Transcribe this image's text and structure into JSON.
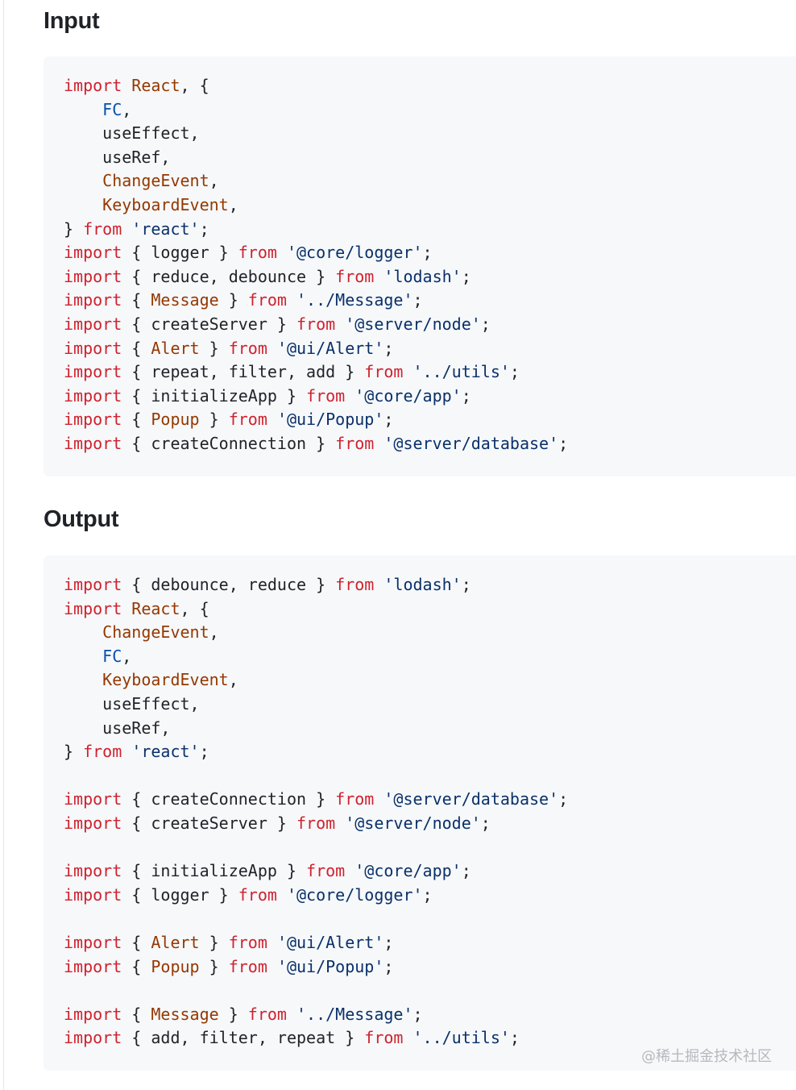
{
  "sections": [
    {
      "heading": "Input",
      "lines": [
        [
          {
            "t": "import",
            "c": "keyword"
          },
          {
            "t": " ",
            "c": "plain"
          },
          {
            "t": "React",
            "c": "ident"
          },
          {
            "t": ", {",
            "c": "plain"
          }
        ],
        [
          {
            "t": "    ",
            "c": "plain"
          },
          {
            "t": "FC",
            "c": "const"
          },
          {
            "t": ",",
            "c": "plain"
          }
        ],
        [
          {
            "t": "    useEffect,",
            "c": "plain"
          }
        ],
        [
          {
            "t": "    useRef,",
            "c": "plain"
          }
        ],
        [
          {
            "t": "    ",
            "c": "plain"
          },
          {
            "t": "ChangeEvent",
            "c": "ident"
          },
          {
            "t": ",",
            "c": "plain"
          }
        ],
        [
          {
            "t": "    ",
            "c": "plain"
          },
          {
            "t": "KeyboardEvent",
            "c": "ident"
          },
          {
            "t": ",",
            "c": "plain"
          }
        ],
        [
          {
            "t": "} ",
            "c": "plain"
          },
          {
            "t": "from",
            "c": "keyword"
          },
          {
            "t": " ",
            "c": "plain"
          },
          {
            "t": "'react'",
            "c": "string"
          },
          {
            "t": ";",
            "c": "plain"
          }
        ],
        [
          {
            "t": "import",
            "c": "keyword"
          },
          {
            "t": " { logger } ",
            "c": "plain"
          },
          {
            "t": "from",
            "c": "keyword"
          },
          {
            "t": " ",
            "c": "plain"
          },
          {
            "t": "'@core/logger'",
            "c": "string"
          },
          {
            "t": ";",
            "c": "plain"
          }
        ],
        [
          {
            "t": "import",
            "c": "keyword"
          },
          {
            "t": " { reduce, debounce } ",
            "c": "plain"
          },
          {
            "t": "from",
            "c": "keyword"
          },
          {
            "t": " ",
            "c": "plain"
          },
          {
            "t": "'lodash'",
            "c": "string"
          },
          {
            "t": ";",
            "c": "plain"
          }
        ],
        [
          {
            "t": "import",
            "c": "keyword"
          },
          {
            "t": " { ",
            "c": "plain"
          },
          {
            "t": "Message",
            "c": "ident"
          },
          {
            "t": " } ",
            "c": "plain"
          },
          {
            "t": "from",
            "c": "keyword"
          },
          {
            "t": " ",
            "c": "plain"
          },
          {
            "t": "'../Message'",
            "c": "string"
          },
          {
            "t": ";",
            "c": "plain"
          }
        ],
        [
          {
            "t": "import",
            "c": "keyword"
          },
          {
            "t": " { createServer } ",
            "c": "plain"
          },
          {
            "t": "from",
            "c": "keyword"
          },
          {
            "t": " ",
            "c": "plain"
          },
          {
            "t": "'@server/node'",
            "c": "string"
          },
          {
            "t": ";",
            "c": "plain"
          }
        ],
        [
          {
            "t": "import",
            "c": "keyword"
          },
          {
            "t": " { ",
            "c": "plain"
          },
          {
            "t": "Alert",
            "c": "ident"
          },
          {
            "t": " } ",
            "c": "plain"
          },
          {
            "t": "from",
            "c": "keyword"
          },
          {
            "t": " ",
            "c": "plain"
          },
          {
            "t": "'@ui/Alert'",
            "c": "string"
          },
          {
            "t": ";",
            "c": "plain"
          }
        ],
        [
          {
            "t": "import",
            "c": "keyword"
          },
          {
            "t": " { repeat, filter, add } ",
            "c": "plain"
          },
          {
            "t": "from",
            "c": "keyword"
          },
          {
            "t": " ",
            "c": "plain"
          },
          {
            "t": "'../utils'",
            "c": "string"
          },
          {
            "t": ";",
            "c": "plain"
          }
        ],
        [
          {
            "t": "import",
            "c": "keyword"
          },
          {
            "t": " { initializeApp } ",
            "c": "plain"
          },
          {
            "t": "from",
            "c": "keyword"
          },
          {
            "t": " ",
            "c": "plain"
          },
          {
            "t": "'@core/app'",
            "c": "string"
          },
          {
            "t": ";",
            "c": "plain"
          }
        ],
        [
          {
            "t": "import",
            "c": "keyword"
          },
          {
            "t": " { ",
            "c": "plain"
          },
          {
            "t": "Popup",
            "c": "ident"
          },
          {
            "t": " } ",
            "c": "plain"
          },
          {
            "t": "from",
            "c": "keyword"
          },
          {
            "t": " ",
            "c": "plain"
          },
          {
            "t": "'@ui/Popup'",
            "c": "string"
          },
          {
            "t": ";",
            "c": "plain"
          }
        ],
        [
          {
            "t": "import",
            "c": "keyword"
          },
          {
            "t": " { createConnection } ",
            "c": "plain"
          },
          {
            "t": "from",
            "c": "keyword"
          },
          {
            "t": " ",
            "c": "plain"
          },
          {
            "t": "'@server/database'",
            "c": "string"
          },
          {
            "t": ";",
            "c": "plain"
          }
        ]
      ]
    },
    {
      "heading": "Output",
      "lines": [
        [
          {
            "t": "import",
            "c": "keyword"
          },
          {
            "t": " { debounce, reduce } ",
            "c": "plain"
          },
          {
            "t": "from",
            "c": "keyword"
          },
          {
            "t": " ",
            "c": "plain"
          },
          {
            "t": "'lodash'",
            "c": "string"
          },
          {
            "t": ";",
            "c": "plain"
          }
        ],
        [
          {
            "t": "import",
            "c": "keyword"
          },
          {
            "t": " ",
            "c": "plain"
          },
          {
            "t": "React",
            "c": "ident"
          },
          {
            "t": ", {",
            "c": "plain"
          }
        ],
        [
          {
            "t": "    ",
            "c": "plain"
          },
          {
            "t": "ChangeEvent",
            "c": "ident"
          },
          {
            "t": ",",
            "c": "plain"
          }
        ],
        [
          {
            "t": "    ",
            "c": "plain"
          },
          {
            "t": "FC",
            "c": "const"
          },
          {
            "t": ",",
            "c": "plain"
          }
        ],
        [
          {
            "t": "    ",
            "c": "plain"
          },
          {
            "t": "KeyboardEvent",
            "c": "ident"
          },
          {
            "t": ",",
            "c": "plain"
          }
        ],
        [
          {
            "t": "    useEffect,",
            "c": "plain"
          }
        ],
        [
          {
            "t": "    useRef,",
            "c": "plain"
          }
        ],
        [
          {
            "t": "} ",
            "c": "plain"
          },
          {
            "t": "from",
            "c": "keyword"
          },
          {
            "t": " ",
            "c": "plain"
          },
          {
            "t": "'react'",
            "c": "string"
          },
          {
            "t": ";",
            "c": "plain"
          }
        ],
        [],
        [
          {
            "t": "import",
            "c": "keyword"
          },
          {
            "t": " { createConnection } ",
            "c": "plain"
          },
          {
            "t": "from",
            "c": "keyword"
          },
          {
            "t": " ",
            "c": "plain"
          },
          {
            "t": "'@server/database'",
            "c": "string"
          },
          {
            "t": ";",
            "c": "plain"
          }
        ],
        [
          {
            "t": "import",
            "c": "keyword"
          },
          {
            "t": " { createServer } ",
            "c": "plain"
          },
          {
            "t": "from",
            "c": "keyword"
          },
          {
            "t": " ",
            "c": "plain"
          },
          {
            "t": "'@server/node'",
            "c": "string"
          },
          {
            "t": ";",
            "c": "plain"
          }
        ],
        [],
        [
          {
            "t": "import",
            "c": "keyword"
          },
          {
            "t": " { initializeApp } ",
            "c": "plain"
          },
          {
            "t": "from",
            "c": "keyword"
          },
          {
            "t": " ",
            "c": "plain"
          },
          {
            "t": "'@core/app'",
            "c": "string"
          },
          {
            "t": ";",
            "c": "plain"
          }
        ],
        [
          {
            "t": "import",
            "c": "keyword"
          },
          {
            "t": " { logger } ",
            "c": "plain"
          },
          {
            "t": "from",
            "c": "keyword"
          },
          {
            "t": " ",
            "c": "plain"
          },
          {
            "t": "'@core/logger'",
            "c": "string"
          },
          {
            "t": ";",
            "c": "plain"
          }
        ],
        [],
        [
          {
            "t": "import",
            "c": "keyword"
          },
          {
            "t": " { ",
            "c": "plain"
          },
          {
            "t": "Alert",
            "c": "ident"
          },
          {
            "t": " } ",
            "c": "plain"
          },
          {
            "t": "from",
            "c": "keyword"
          },
          {
            "t": " ",
            "c": "plain"
          },
          {
            "t": "'@ui/Alert'",
            "c": "string"
          },
          {
            "t": ";",
            "c": "plain"
          }
        ],
        [
          {
            "t": "import",
            "c": "keyword"
          },
          {
            "t": " { ",
            "c": "plain"
          },
          {
            "t": "Popup",
            "c": "ident"
          },
          {
            "t": " } ",
            "c": "plain"
          },
          {
            "t": "from",
            "c": "keyword"
          },
          {
            "t": " ",
            "c": "plain"
          },
          {
            "t": "'@ui/Popup'",
            "c": "string"
          },
          {
            "t": ";",
            "c": "plain"
          }
        ],
        [],
        [
          {
            "t": "import",
            "c": "keyword"
          },
          {
            "t": " { ",
            "c": "plain"
          },
          {
            "t": "Message",
            "c": "ident"
          },
          {
            "t": " } ",
            "c": "plain"
          },
          {
            "t": "from",
            "c": "keyword"
          },
          {
            "t": " ",
            "c": "plain"
          },
          {
            "t": "'../Message'",
            "c": "string"
          },
          {
            "t": ";",
            "c": "plain"
          }
        ],
        [
          {
            "t": "import",
            "c": "keyword"
          },
          {
            "t": " { add, filter, repeat } ",
            "c": "plain"
          },
          {
            "t": "from",
            "c": "keyword"
          },
          {
            "t": " ",
            "c": "plain"
          },
          {
            "t": "'../utils'",
            "c": "string"
          },
          {
            "t": ";",
            "c": "plain"
          }
        ]
      ]
    }
  ],
  "watermark": "@稀土掘金技术社区",
  "colors": {
    "keyword": "#cf222e",
    "ident": "#953800",
    "const": "#0550ae",
    "string": "#0a3069",
    "plain": "#1f2328",
    "code_background": "#f6f8fa"
  }
}
